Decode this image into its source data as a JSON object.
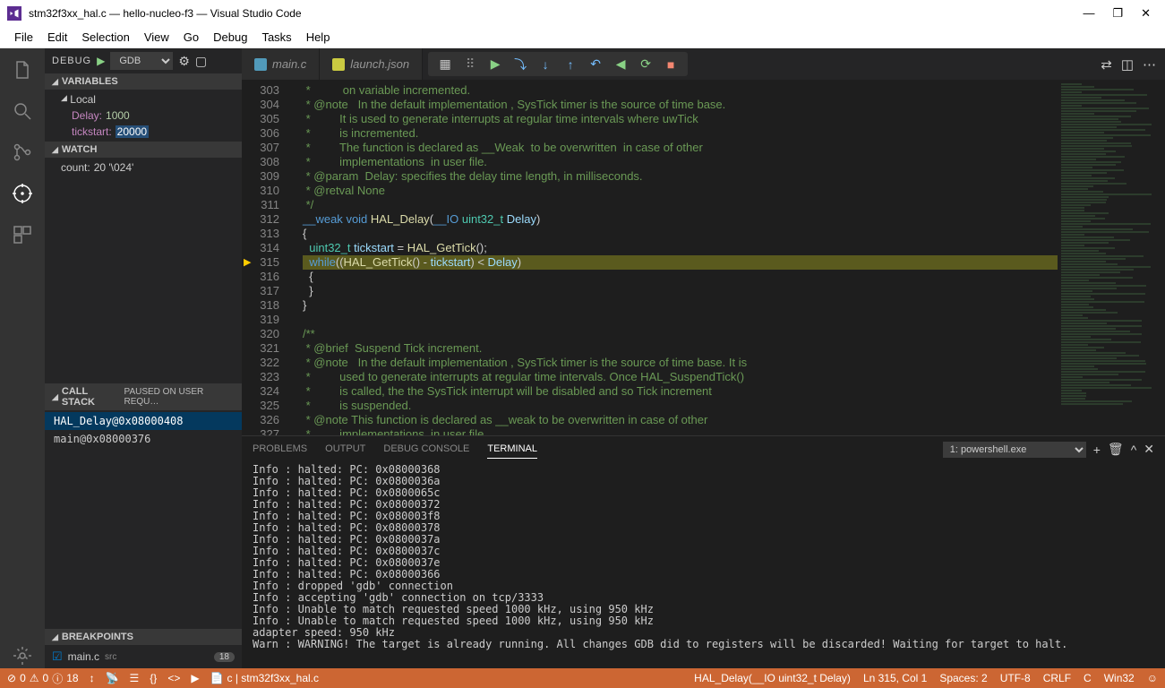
{
  "title": "stm32f3xx_hal.c — hello-nucleo-f3 — Visual Studio Code",
  "menu": [
    "File",
    "Edit",
    "Selection",
    "View",
    "Go",
    "Debug",
    "Tasks",
    "Help"
  ],
  "debugHeader": {
    "label": "DEBUG",
    "config": "GDB"
  },
  "sections": {
    "variables": {
      "title": "VARIABLES",
      "scope": "Local",
      "vars": [
        {
          "name": "Delay:",
          "value": "1000"
        },
        {
          "name": "tickstart:",
          "value": "20000",
          "selected": true
        }
      ]
    },
    "watch": {
      "title": "WATCH",
      "items": [
        {
          "expr": "count:",
          "value": "20 '\\024'"
        }
      ]
    },
    "callstack": {
      "title": "CALL STACK",
      "status": "PAUSED ON USER REQU…",
      "frames": [
        {
          "label": "HAL_Delay@0x08000408",
          "selected": true
        },
        {
          "label": "main@0x08000376"
        }
      ]
    },
    "breakpoints": {
      "title": "BREAKPOINTS",
      "items": [
        {
          "file": "main.c",
          "src": "src",
          "count": "18"
        }
      ]
    }
  },
  "tabs": [
    {
      "label": "main.c",
      "icon": "c",
      "active": false
    },
    {
      "label": "launch.json",
      "icon": "json",
      "active": false
    }
  ],
  "editorTabActive": {
    "file": "stm32f3xx_hal.c"
  },
  "gutterStart": 303,
  "currentLine": 315,
  "codeLines": [
    {
      "n": 303,
      "html": " *          on variable incremented.",
      "cls": "c-comment"
    },
    {
      "n": 304,
      "html": " * @note   In the default implementation , SysTick timer is the source of time base.",
      "cls": "c-comment"
    },
    {
      "n": 305,
      "html": " *         It is used to generate interrupts at regular time intervals where uwTick",
      "cls": "c-comment"
    },
    {
      "n": 306,
      "html": " *         is incremented.",
      "cls": "c-comment"
    },
    {
      "n": 307,
      "html": " *         The function is declared as __Weak  to be overwritten  in case of other",
      "cls": "c-comment"
    },
    {
      "n": 308,
      "html": " *         implementations  in user file.",
      "cls": "c-comment"
    },
    {
      "n": 309,
      "html": " * @param  Delay: specifies the delay time length, in milliseconds.",
      "cls": "c-comment"
    },
    {
      "n": 310,
      "html": " * @retval None",
      "cls": "c-comment"
    },
    {
      "n": 311,
      "html": " */",
      "cls": "c-comment"
    },
    {
      "n": 312,
      "raw": "<span class='c-kw'>__weak</span> <span class='c-kw'>void</span> <span class='c-fn'>HAL_Delay</span>(<span class='c-kw'>__IO</span> <span class='c-type'>uint32_t</span> <span class='c-var'>Delay</span>)"
    },
    {
      "n": 313,
      "html": "{"
    },
    {
      "n": 314,
      "raw": "  <span class='c-type'>uint32_t</span> <span class='c-var'>tickstart</span> = <span class='c-fn'>HAL_GetTick</span>();"
    },
    {
      "n": 315,
      "hl": true,
      "raw": "  <span class='c-kw'>while</span>((<span class='c-fn'>HAL_GetTick</span>() - <span class='c-var'>tickstart</span>) &lt; <span class='c-var'>Delay</span>)"
    },
    {
      "n": 316,
      "html": "  {"
    },
    {
      "n": 317,
      "html": "  }"
    },
    {
      "n": 318,
      "html": "}"
    },
    {
      "n": 319,
      "html": ""
    },
    {
      "n": 320,
      "html": "/**",
      "cls": "c-comment"
    },
    {
      "n": 321,
      "html": " * @brief  Suspend Tick increment.",
      "cls": "c-comment"
    },
    {
      "n": 322,
      "html": " * @note   In the default implementation , SysTick timer is the source of time base. It is",
      "cls": "c-comment"
    },
    {
      "n": 323,
      "html": " *         used to generate interrupts at regular time intervals. Once HAL_SuspendTick()",
      "cls": "c-comment"
    },
    {
      "n": 324,
      "html": " *         is called, the the SysTick interrupt will be disabled and so Tick increment",
      "cls": "c-comment"
    },
    {
      "n": 325,
      "html": " *         is suspended.",
      "cls": "c-comment"
    },
    {
      "n": 326,
      "html": " * @note This function is declared as __weak to be overwritten in case of other",
      "cls": "c-comment"
    },
    {
      "n": 327,
      "html": " *         implementations  in user file.",
      "cls": "c-comment"
    }
  ],
  "panel": {
    "tabs": [
      "PROBLEMS",
      "OUTPUT",
      "DEBUG CONSOLE",
      "TERMINAL"
    ],
    "active": "TERMINAL",
    "terminalName": "1: powershell.exe",
    "lines": [
      "Info : halted: PC: 0x08000368",
      "Info : halted: PC: 0x0800036a",
      "Info : halted: PC: 0x0800065c",
      "Info : halted: PC: 0x08000372",
      "Info : halted: PC: 0x080003f8",
      "Info : halted: PC: 0x08000378",
      "Info : halted: PC: 0x0800037a",
      "Info : halted: PC: 0x0800037c",
      "Info : halted: PC: 0x0800037e",
      "Info : halted: PC: 0x08000366",
      "Info : dropped 'gdb' connection",
      "Info : accepting 'gdb' connection on tcp/3333",
      "Info : Unable to match requested speed 1000 kHz, using 950 kHz",
      "Info : Unable to match requested speed 1000 kHz, using 950 kHz",
      "adapter speed: 950 kHz",
      "Warn : WARNING! The target is already running. All changes GDB did to registers will be discarded! Waiting for target to halt."
    ]
  },
  "status": {
    "errors": "0",
    "warnings": "0",
    "info": "18",
    "breadcrumb": "c | stm32f3xx_hal.c",
    "context": "HAL_Delay(__IO uint32_t Delay)",
    "pos": "Ln 315, Col 1",
    "spaces": "Spaces: 2",
    "enc": "UTF-8",
    "eol": "CRLF",
    "lang": "C",
    "host": "Win32"
  }
}
